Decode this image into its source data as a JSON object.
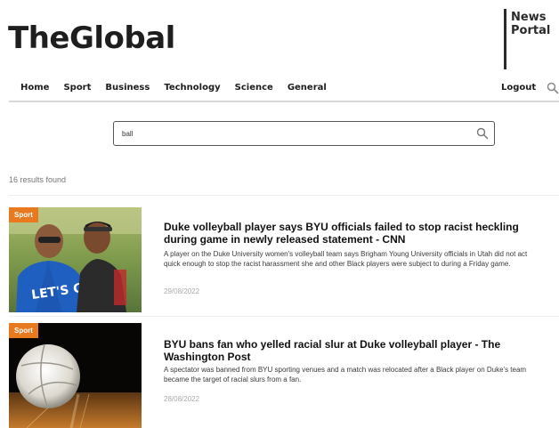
{
  "brand": {
    "logo": "TheGlobal",
    "tagline_line1": "News",
    "tagline_line2": "Portal"
  },
  "nav": {
    "items": [
      {
        "label": "Home"
      },
      {
        "label": "Sport"
      },
      {
        "label": "Business"
      },
      {
        "label": "Technology"
      },
      {
        "label": "Science"
      },
      {
        "label": "General"
      }
    ],
    "logout_label": "Logout",
    "search_icon": "search-icon"
  },
  "search": {
    "value": "ball",
    "icon": "search-icon"
  },
  "results": {
    "count_text": "16 results found",
    "items": [
      {
        "category": "Sport",
        "title": "Duke volleyball player says BYU officials failed to stop racist heckling during game in newly released statement - CNN",
        "description": "A player on the Duke University women's volleyball team says Brigham Young University officials in Utah did not act quick enough to stop the racist harassment she and other Black players were subject to during a Friday game.",
        "date": "29/08/2022",
        "shirt_text": "LET'S GO"
      },
      {
        "category": "Sport",
        "title": "BYU bans fan who yelled racial slur at Duke volleyball player - The Washington Post",
        "description": "A spectator was banned from BYU sporting venues and a match was relocated after a Black player on Duke's team became the target of racial slurs from a fan.",
        "date": "28/08/2022"
      }
    ]
  },
  "colors": {
    "badge": "#e8791e",
    "text": "#1b1b1b",
    "muted": "#aaaaaa"
  }
}
